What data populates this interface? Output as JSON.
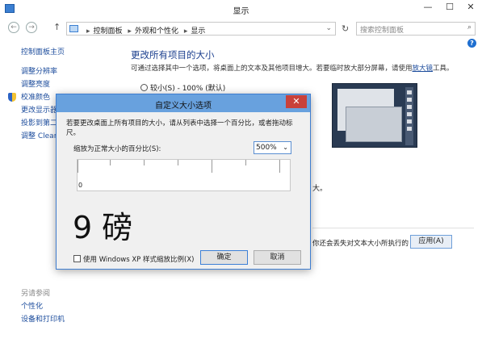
{
  "window": {
    "title": "显示",
    "minimize": "—",
    "maximize": "☐",
    "close": "✕"
  },
  "nav": {
    "back": "←",
    "forward": "→",
    "up": "↑",
    "breadcrumbs": [
      "控制面板",
      "外观和个性化",
      "显示"
    ],
    "refresh": "↻",
    "search_placeholder": "搜索控制面板"
  },
  "sidebar": {
    "home": "控制面板主页",
    "items": [
      "调整分辨率",
      "调整亮度",
      "校准颜色",
      "更改显示器...",
      "投影到第二...",
      "调整 ClearT..."
    ]
  },
  "see_also": {
    "header": "另请参阅",
    "items": [
      "个性化",
      "设备和打印机"
    ]
  },
  "main": {
    "title": "更改所有项目的大小",
    "description": "可通过选择其中一个选项，将桌面上的文本及其他项目增大。若要临时放大部分屏幕，请使用",
    "magnifier_link": "放大镜",
    "description_end": "工具。",
    "option_small": "较小(S) - 100% (默认)",
    "partial_text_1": "大。",
    "partial_text_2": "你还会丢失对文本大小所执行的",
    "apply_button": "应用(A)"
  },
  "dialog": {
    "title": "自定义大小选项",
    "close": "✕",
    "description": "若要更改桌面上所有项目的大小，请从列表中选择一个百分比，或者拖动标尺。",
    "scale_label": "缩放为正常大小的百分比(S):",
    "scale_value": "500%",
    "ruler_zero": "0",
    "sample_text": "9 磅",
    "checkbox_label": "使用 Windows XP 样式缩放比例(X)",
    "ok_button": "确定",
    "cancel_button": "取消"
  }
}
